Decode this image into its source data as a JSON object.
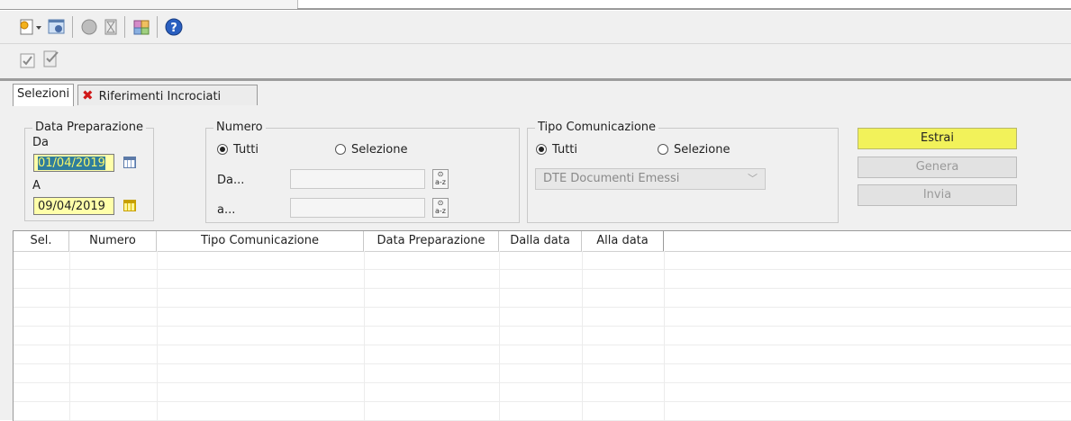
{
  "tabs": {
    "selezioni": "Selezioni",
    "riferimenti": "Riferimenti Incrociati",
    "close_glyph": "✖"
  },
  "data_preparazione": {
    "legend": "Data Preparazione",
    "da_label": "Da",
    "da_value": "01/04/2019",
    "a_label": "A",
    "a_value": "09/04/2019"
  },
  "numero": {
    "legend": "Numero",
    "radio_tutti": "Tutti",
    "radio_selezione": "Selezione",
    "da_label": "Da...",
    "a_label": "a...",
    "da_value": "",
    "a_value": ""
  },
  "tipo_comunicazione": {
    "legend": "Tipo Comunicazione",
    "radio_tutti": "Tutti",
    "radio_selezione": "Selezione",
    "select_value": "DTE Documenti Emessi"
  },
  "actions": {
    "estrai": "Estrai",
    "genera": "Genera",
    "invia": "Invia"
  },
  "grid": {
    "columns": [
      "Sel.",
      "Numero",
      "Tipo Comunicazione",
      "Data Preparazione",
      "Dalla data",
      "Alla data"
    ]
  },
  "icons": {
    "toolbar1": [
      "new-document-icon",
      "dropdown-arrow-icon",
      "settings-window-icon",
      "circle-icon",
      "hourglass-icon",
      "cube-icon",
      "help-icon"
    ],
    "toolbar2": [
      "checkbox-icon",
      "edit-check-icon"
    ]
  },
  "colors": {
    "highlight": "#f2f25a",
    "date_bg": "#ffffaa"
  }
}
